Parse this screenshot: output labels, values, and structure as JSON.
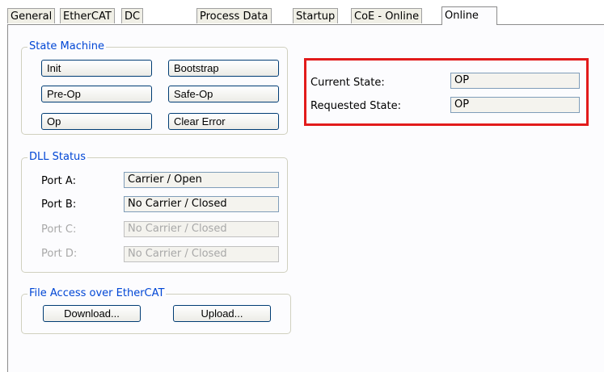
{
  "tabs": [
    "General",
    "EtherCAT",
    "DC",
    "Process Data",
    "Startup",
    "CoE - Online",
    "Online"
  ],
  "active_tab": "Online",
  "state_machine": {
    "title": "State Machine",
    "buttons": [
      "Init",
      "Bootstrap",
      "Pre-Op",
      "Safe-Op",
      "Op",
      "Clear Error"
    ],
    "current_state_label": "Current State:",
    "current_state_value": "OP",
    "requested_state_label": "Requested State:",
    "requested_state_value": "OP"
  },
  "dll_status": {
    "title": "DLL Status",
    "ports": [
      {
        "label": "Port A:",
        "value": "Carrier / Open",
        "enabled": true
      },
      {
        "label": "Port B:",
        "value": "No Carrier / Closed",
        "enabled": true
      },
      {
        "label": "Port C:",
        "value": "No Carrier / Closed",
        "enabled": false
      },
      {
        "label": "Port D:",
        "value": "No Carrier / Closed",
        "enabled": false
      }
    ]
  },
  "file_access": {
    "title": "File Access over EtherCAT",
    "download_label": "Download...",
    "upload_label": "Upload..."
  },
  "colors": {
    "group_title": "#0046d5",
    "highlight_border": "#e21b1b",
    "panel_bg": "#fcfcfe"
  }
}
